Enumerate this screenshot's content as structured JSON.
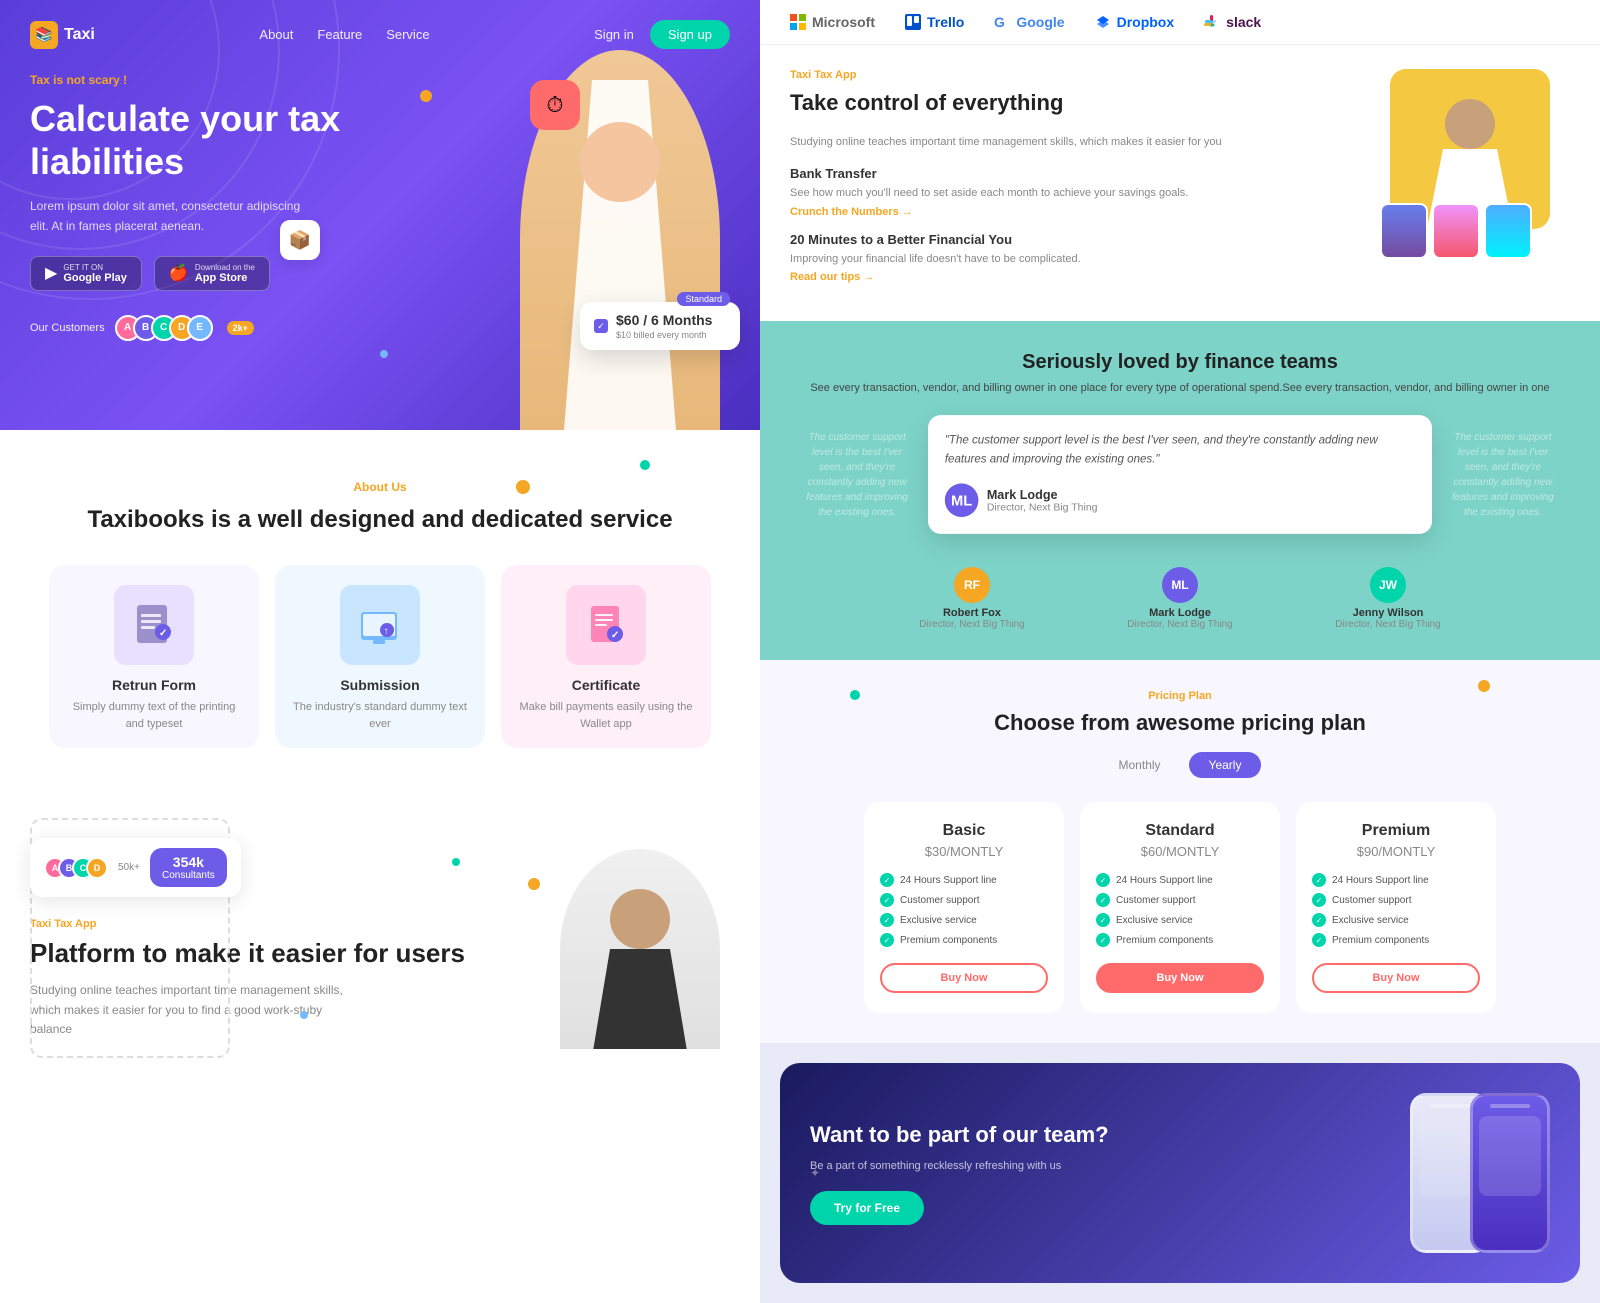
{
  "leftPanel": {
    "nav": {
      "logo": "Taxi",
      "links": [
        "About",
        "Feature",
        "Service"
      ],
      "signin": "Sign in",
      "signup": "Sign up"
    },
    "hero": {
      "tag": "Tax is not scary !",
      "title": "Calculate your tax liabilities",
      "desc": "Lorem ipsum dolor sit amet, consectetur adipiscing elit. At in fames placerat aenean.",
      "googlePlay": {
        "small": "GET IT ON",
        "big": "Google Play"
      },
      "appStore": {
        "small": "Download on the",
        "big": "App Store"
      },
      "customersLabel": "Our Customers",
      "customerCount": "2k+"
    },
    "priceCard": {
      "badge": "Standard",
      "price": "$60 / 6 Months",
      "sub": "$10 billed every month"
    },
    "about": {
      "tag": "About Us",
      "title": "Taxibooks is a well designed and dedicated service"
    },
    "features": [
      {
        "icon": "📋",
        "name": "Retrun Form",
        "desc": "Simply dummy text of the printing and typeset"
      },
      {
        "icon": "🖥️",
        "name": "Submission",
        "desc": "The industry's standard dummy text ever"
      },
      {
        "icon": "📄",
        "name": "Certificate",
        "desc": "Make bill payments easily using the Wallet app"
      }
    ],
    "consultants": {
      "number": "354k",
      "label": "Consultants"
    },
    "platform": {
      "tag": "Taxi Tax App",
      "title": "Platform to make it easier for users",
      "desc": "Studying online teaches important time management skills, which makes it easier for you to find a good work-stuby balance"
    }
  },
  "rightPanel": {
    "brands": [
      {
        "name": "Microsoft",
        "color": "#666"
      },
      {
        "name": "Trello",
        "color": "#0052cc"
      },
      {
        "name": "Google",
        "color": "#4285f4"
      },
      {
        "name": "Dropbox",
        "color": "#0061ff"
      },
      {
        "name": "slack",
        "color": "#4a154b"
      }
    ],
    "control": {
      "tag": "Taxi Tax App",
      "title": "Take control of everything",
      "item1": {
        "title": "Bank Transfer",
        "desc": "See how much you'll need to set aside each month to achieve your savings goals.",
        "link": "Crunch the Numbers →"
      },
      "item2": {
        "title": "20 Minutes to a Better Financial You",
        "desc": "Improving your financial life doesn't have to be complicated.",
        "link": "Read our tips →"
      }
    },
    "testimonials": {
      "title": "Seriously loved by finance teams",
      "desc": "See every transaction, vendor, and billing owner in one place for every type of operational spend.See every transaction, vendor, and billing owner in one",
      "items": [
        {
          "quote": "The customer support level is the best I'ver seen, and they're constantly adding new features and improving the existing ones.",
          "name": "Robert Fox",
          "role": "Director, Next Big Thing",
          "color": "#f5a623"
        },
        {
          "quote": "\"The customer support level is the best I'ver seen, and they're constantly adding new features and improving the existing ones.\"",
          "name": "Mark Lodge",
          "role": "Director, Next Big Thing",
          "color": "#6c5ce7"
        },
        {
          "quote": "The customer support level is the best I'ver seen, and they're constantly adding new features and improving the existing ones.",
          "name": "Jenny Wilson",
          "role": "Director, Next Big Thing",
          "color": "#00d4aa"
        }
      ]
    },
    "pricing": {
      "tag": "Pricing Plan",
      "title": "Choose from awesome pricing plan",
      "toggleMonthly": "Monthly",
      "toggleYearly": "Yearly",
      "plans": [
        {
          "name": "Basic",
          "price": "$30/MONTLY",
          "features": [
            "24 Hours Support line",
            "Customer support",
            "Exclusive service",
            "Premium components"
          ],
          "btnLabel": "Buy Now",
          "filled": false
        },
        {
          "name": "Standard",
          "price": "$60/MONTLY",
          "features": [
            "24 Hours Support line",
            "Customer support",
            "Exclusive service",
            "Premium components"
          ],
          "btnLabel": "Buy Now",
          "filled": true
        },
        {
          "name": "Premium",
          "price": "$90/MONTLY",
          "features": [
            "24 Hours Support line",
            "Customer support",
            "Exclusive service",
            "Premium components"
          ],
          "btnLabel": "Buy Now",
          "filled": false
        }
      ]
    },
    "cta": {
      "title": "Want to be part of our team?",
      "desc": "Be a part of something recklessly refreshing with us",
      "btnLabel": "Try for Free"
    }
  }
}
